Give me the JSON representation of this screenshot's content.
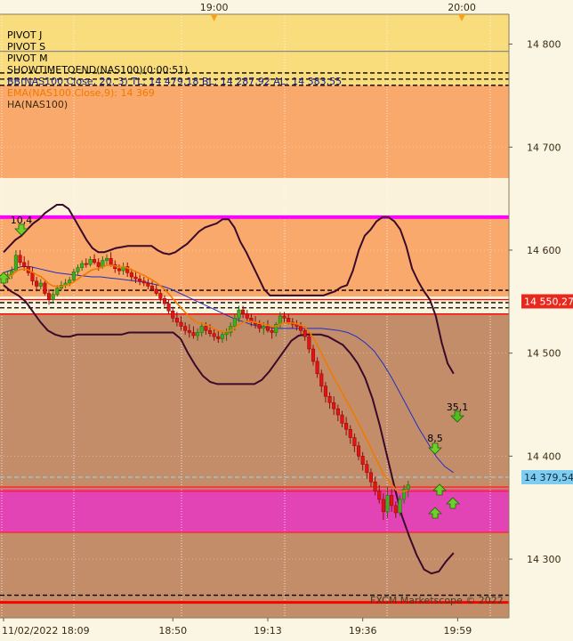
{
  "chart_data": {
    "type": "candlestick",
    "instrument": "NAS100",
    "title": "",
    "copyright": "FXCM Marketscope © 2022",
    "y_ticks": [
      "14 800",
      "14 700",
      "14 600",
      "14 500",
      "14 400",
      "14 300"
    ],
    "y_tick_values": [
      14800,
      14700,
      14600,
      14500,
      14400,
      14300
    ],
    "ylim": [
      14243,
      14829
    ],
    "x_ticks_bottom": [
      "11/02/2022 18:09",
      "18:50",
      "19:13",
      "19:36",
      "19:59"
    ],
    "x_ticks_top": [
      "19:00",
      "20:00"
    ],
    "x_tick_bars": [
      0,
      41,
      64,
      87,
      110
    ],
    "top_tick_bars": [
      51,
      111
    ],
    "price_tags": [
      {
        "label": "14 550,27",
        "value": 14550.27,
        "color": "#e8281c"
      },
      {
        "label": "14 379,54",
        "value": 14379.54,
        "color": "#7ecdf0"
      }
    ],
    "legend": [
      {
        "text": "PIVOT J",
        "color": "#000000"
      },
      {
        "text": "PIVOT S",
        "color": "#000000"
      },
      {
        "text": "PIVOT M",
        "color": "#000000"
      },
      {
        "text": "SHOWTIMETOEND(NAS100)(0:00:51)",
        "color": "#000000"
      },
      {
        "text": "BB(NAS100.Close, 20, 3)  TL: 14 479,18  BL: 14 287,92  AL: 14 383,55",
        "color": "#1a1aa0"
      },
      {
        "text": "EMA(NAS100.Close,9): 14 369",
        "color": "#f07a00"
      },
      {
        "text": "HA(NAS100)",
        "color": "#3a2a10"
      }
    ],
    "zones": [
      {
        "from": 14760,
        "to": 14829,
        "color": "#f9dd7c"
      },
      {
        "from": 14670,
        "to": 14760,
        "color": "#f9a96b"
      },
      {
        "from": 14555,
        "to": 14632,
        "color": "#f9a96b"
      },
      {
        "from": 14243,
        "to": 14538,
        "color": "#c48d6a"
      },
      {
        "from": 14326,
        "to": 14368,
        "color": "#e344b5"
      }
    ],
    "lines": [
      {
        "value": 14793,
        "color": "#8a8a8a",
        "dash": false
      },
      {
        "value": 14772,
        "color": "#000000",
        "dash": true
      },
      {
        "value": 14766,
        "color": "#000000",
        "dash": true
      },
      {
        "value": 14760,
        "color": "#000000",
        "dash": true
      },
      {
        "value": 14632,
        "color": "#ff00ff",
        "dash": false,
        "width": 4
      },
      {
        "value": 14561,
        "color": "#000000",
        "dash": true
      },
      {
        "value": 14552,
        "color": "#ff0000",
        "dash": false
      },
      {
        "value": 14549,
        "color": "#000000",
        "dash": true
      },
      {
        "value": 14544,
        "color": "#000000",
        "dash": true
      },
      {
        "value": 14538,
        "color": "#ff0000",
        "dash": false
      },
      {
        "value": 14379.54,
        "color": "#9ac7e0",
        "dash": true
      },
      {
        "value": 14370,
        "color": "#ff2020",
        "dash": false
      },
      {
        "value": 14366,
        "color": "#ff2020",
        "dash": false
      },
      {
        "value": 14326,
        "color": "#ff2020",
        "dash": false
      },
      {
        "value": 14265,
        "color": "#000000",
        "dash": true
      },
      {
        "value": 14258,
        "color": "#ff0000",
        "dash": false,
        "width": 3
      }
    ],
    "candles": [
      [
        14572,
        14578,
        14566,
        14574
      ],
      [
        14574,
        14580,
        14568,
        14576
      ],
      [
        14576,
        14584,
        14572,
        14580
      ],
      [
        14580,
        14600,
        14578,
        14595
      ],
      [
        14595,
        14600,
        14585,
        14588
      ],
      [
        14588,
        14594,
        14580,
        14584
      ],
      [
        14584,
        14590,
        14575,
        14578
      ],
      [
        14578,
        14584,
        14566,
        14570
      ],
      [
        14570,
        14574,
        14560,
        14565
      ],
      [
        14565,
        14572,
        14562,
        14568
      ],
      [
        14568,
        14570,
        14556,
        14558
      ],
      [
        14558,
        14562,
        14547,
        14552
      ],
      [
        14552,
        14560,
        14550,
        14557
      ],
      [
        14557,
        14566,
        14555,
        14563
      ],
      [
        14563,
        14570,
        14561,
        14566
      ],
      [
        14566,
        14572,
        14563,
        14568
      ],
      [
        14568,
        14574,
        14565,
        14571
      ],
      [
        14571,
        14582,
        14569,
        14579
      ],
      [
        14579,
        14586,
        14576,
        14583
      ],
      [
        14583,
        14590,
        14580,
        14587
      ],
      [
        14587,
        14592,
        14583,
        14586
      ],
      [
        14586,
        14594,
        14584,
        14591
      ],
      [
        14591,
        14596,
        14586,
        14588
      ],
      [
        14588,
        14592,
        14580,
        14584
      ],
      [
        14584,
        14594,
        14582,
        14590
      ],
      [
        14590,
        14596,
        14586,
        14592
      ],
      [
        14592,
        14598,
        14584,
        14586
      ],
      [
        14586,
        14590,
        14578,
        14582
      ],
      [
        14582,
        14586,
        14576,
        14580
      ],
      [
        14580,
        14588,
        14576,
        14584
      ],
      [
        14584,
        14588,
        14574,
        14578
      ],
      [
        14578,
        14582,
        14570,
        14574
      ],
      [
        14574,
        14580,
        14568,
        14572
      ],
      [
        14572,
        14576,
        14566,
        14570
      ],
      [
        14570,
        14574,
        14565,
        14568
      ],
      [
        14568,
        14572,
        14562,
        14565
      ],
      [
        14565,
        14570,
        14560,
        14562
      ],
      [
        14562,
        14566,
        14556,
        14558
      ],
      [
        14558,
        14562,
        14550,
        14553
      ],
      [
        14553,
        14556,
        14545,
        14548
      ],
      [
        14548,
        14552,
        14538,
        14541
      ],
      [
        14541,
        14545,
        14530,
        14534
      ],
      [
        14534,
        14540,
        14526,
        14530
      ],
      [
        14530,
        14536,
        14522,
        14526
      ],
      [
        14526,
        14530,
        14518,
        14522
      ],
      [
        14522,
        14528,
        14515,
        14520
      ],
      [
        14520,
        14526,
        14514,
        14517
      ],
      [
        14517,
        14524,
        14512,
        14520
      ],
      [
        14520,
        14530,
        14516,
        14526
      ],
      [
        14526,
        14530,
        14518,
        14522
      ],
      [
        14522,
        14528,
        14516,
        14519
      ],
      [
        14519,
        14524,
        14512,
        14516
      ],
      [
        14516,
        14522,
        14510,
        14514
      ],
      [
        14514,
        14522,
        14510,
        14518
      ],
      [
        14518,
        14524,
        14512,
        14520
      ],
      [
        14520,
        14530,
        14516,
        14526
      ],
      [
        14526,
        14538,
        14522,
        14534
      ],
      [
        14534,
        14546,
        14530,
        14542
      ],
      [
        14542,
        14546,
        14534,
        14538
      ],
      [
        14538,
        14542,
        14530,
        14534
      ],
      [
        14534,
        14538,
        14526,
        14530
      ],
      [
        14530,
        14536,
        14524,
        14528
      ],
      [
        14528,
        14532,
        14520,
        14524
      ],
      [
        14524,
        14530,
        14518,
        14526
      ],
      [
        14526,
        14532,
        14520,
        14522
      ],
      [
        14522,
        14526,
        14514,
        14520
      ],
      [
        14520,
        14530,
        14516,
        14528
      ],
      [
        14528,
        14540,
        14524,
        14536
      ],
      [
        14536,
        14540,
        14530,
        14534
      ],
      [
        14534,
        14538,
        14528,
        14530
      ],
      [
        14530,
        14534,
        14524,
        14528
      ],
      [
        14528,
        14532,
        14522,
        14526
      ],
      [
        14526,
        14530,
        14518,
        14522
      ],
      [
        14522,
        14526,
        14512,
        14516
      ],
      [
        14516,
        14520,
        14500,
        14504
      ],
      [
        14504,
        14508,
        14488,
        14492
      ],
      [
        14492,
        14496,
        14476,
        14480
      ],
      [
        14480,
        14484,
        14462,
        14468
      ],
      [
        14468,
        14472,
        14452,
        14458
      ],
      [
        14458,
        14462,
        14446,
        14452
      ],
      [
        14452,
        14458,
        14440,
        14446
      ],
      [
        14446,
        14450,
        14434,
        14440
      ],
      [
        14440,
        14444,
        14428,
        14432
      ],
      [
        14432,
        14438,
        14420,
        14426
      ],
      [
        14426,
        14430,
        14412,
        14418
      ],
      [
        14418,
        14422,
        14404,
        14410
      ],
      [
        14410,
        14414,
        14396,
        14400
      ],
      [
        14400,
        14404,
        14386,
        14392
      ],
      [
        14392,
        14396,
        14378,
        14384
      ],
      [
        14384,
        14388,
        14370,
        14375
      ],
      [
        14375,
        14380,
        14362,
        14366
      ],
      [
        14366,
        14372,
        14354,
        14358
      ],
      [
        14358,
        14364,
        14338,
        14346
      ],
      [
        14346,
        14370,
        14340,
        14362
      ],
      [
        14362,
        14368,
        14346,
        14352
      ],
      [
        14352,
        14356,
        14340,
        14345
      ],
      [
        14345,
        14362,
        14342,
        14358
      ],
      [
        14358,
        14372,
        14354,
        14368
      ],
      [
        14368,
        14376,
        14360,
        14372
      ]
    ],
    "bb_upper": [
      14598,
      14604,
      14610,
      14614,
      14620,
      14626,
      14630,
      14636,
      14640,
      14644,
      14644,
      14640,
      14630,
      14620,
      14610,
      14602,
      14598,
      14598,
      14600,
      14602,
      14603,
      14604,
      14604,
      14604,
      14604,
      14604,
      14600,
      14597,
      14596,
      14598,
      14602,
      14606,
      14612,
      14618,
      14622,
      14624,
      14626,
      14630,
      14630,
      14622,
      14608,
      14598,
      14586,
      14574,
      14562,
      14556,
      14556,
      14556,
      14556,
      14556,
      14556,
      14556,
      14556,
      14556,
      14556,
      14558,
      14560,
      14564,
      14566,
      14580,
      14600,
      14614,
      14620,
      14628,
      14632,
      14632,
      14628,
      14620,
      14604,
      14582,
      14570,
      14560,
      14552,
      14536,
      14510,
      14490,
      14480
    ],
    "bb_lower": [
      14566,
      14560,
      14556,
      14550,
      14540,
      14530,
      14522,
      14518,
      14516,
      14516,
      14518,
      14518,
      14518,
      14518,
      14518,
      14518,
      14518,
      14520,
      14520,
      14520,
      14520,
      14520,
      14520,
      14520,
      14514,
      14500,
      14488,
      14478,
      14472,
      14470,
      14470,
      14470,
      14470,
      14470,
      14470,
      14474,
      14482,
      14492,
      14502,
      14512,
      14517,
      14518,
      14518,
      14518,
      14516,
      14512,
      14508,
      14500,
      14490,
      14476,
      14456,
      14430,
      14400,
      14370,
      14342,
      14322,
      14304,
      14290,
      14286,
      14288,
      14298,
      14306
    ],
    "bb_middle": [
      14578,
      14581,
      14584,
      14584,
      14582,
      14580,
      14578,
      14577,
      14576,
      14575,
      14574,
      14574,
      14573,
      14572,
      14571,
      14570,
      14569,
      14567,
      14565,
      14562,
      14558,
      14554,
      14550,
      14546,
      14542,
      14538,
      14534,
      14531,
      14528,
      14526,
      14525,
      14524,
      14524,
      14524,
      14524,
      14524,
      14524,
      14523,
      14522,
      14520,
      14516,
      14510,
      14502,
      14490,
      14476,
      14460,
      14444,
      14428,
      14414,
      14400,
      14390,
      14384
    ]
  }
}
